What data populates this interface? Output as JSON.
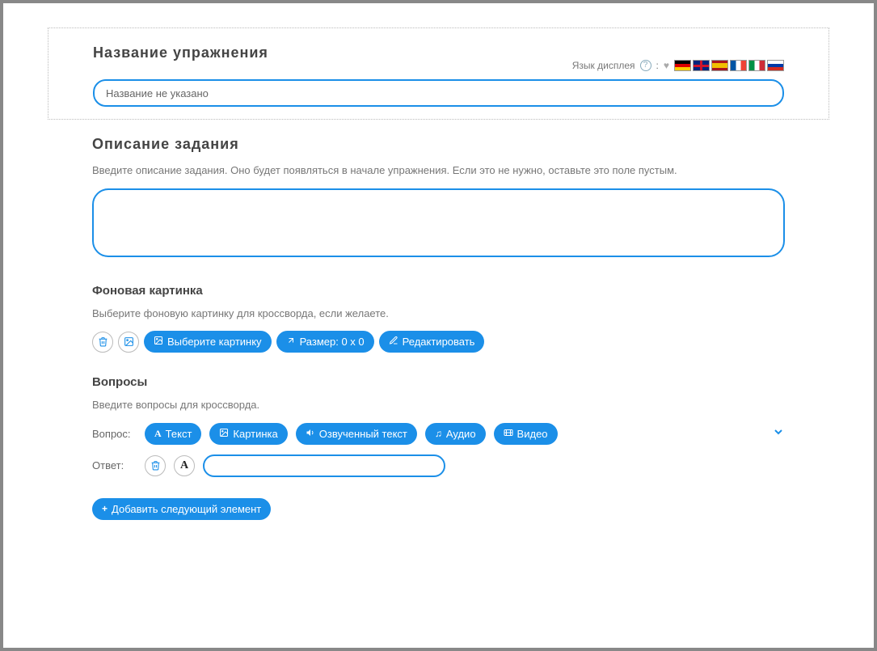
{
  "title_section": {
    "heading": "Название упражнения",
    "lang_label": "Язык дисплея",
    "separator": ":",
    "input_value": "Название не указано"
  },
  "flags": [
    "de",
    "en",
    "es",
    "fr",
    "it",
    "ru"
  ],
  "description_section": {
    "heading": "Описание задания",
    "hint": "Введите описание задания. Оно будет появляться в начале упражнения. Если это не нужно, оставьте это поле пустым.",
    "value": ""
  },
  "background_section": {
    "heading": "Фоновая картинка",
    "hint": "Выберите фоновую картинку для кроссворда, если желаете.",
    "select_label": "Выберите картинку",
    "size_label": "Размер: 0 x 0",
    "edit_label": "Редактировать"
  },
  "questions_section": {
    "heading": "Вопросы",
    "hint": "Введите вопросы для кроссворда.",
    "question_label": "Вопрос:",
    "answer_label": "Ответ:",
    "buttons": {
      "text": "Текст",
      "image": "Картинка",
      "tts": "Озвученный текст",
      "audio": "Аудио",
      "video": "Видео"
    },
    "answer_value": ""
  },
  "add_button": "Добавить следующий элемент",
  "font_letter": "A"
}
